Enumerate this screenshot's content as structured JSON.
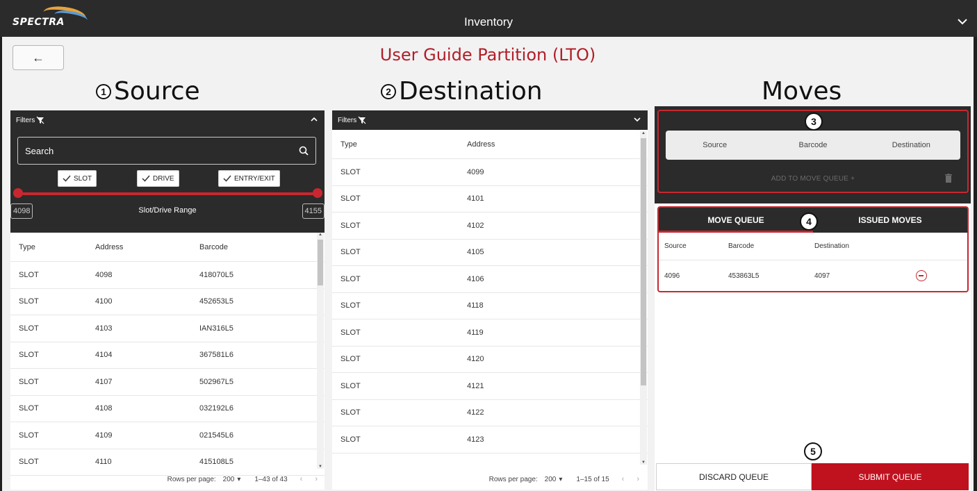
{
  "topbar": {
    "brand": "SPECTRA",
    "title": "Inventory"
  },
  "page": {
    "partition_title": "User Guide Partition (LTO)"
  },
  "columns": {
    "source_title": "Source",
    "source_num": "1",
    "destination_title": "Destination",
    "destination_num": "2",
    "moves_title": "Moves"
  },
  "source": {
    "filters_label": "Filters",
    "search_placeholder": "Search",
    "checks": {
      "slot": "SLOT",
      "drive": "DRIVE",
      "entry": "ENTRY/EXIT"
    },
    "range": {
      "min": "4098",
      "max": "4155",
      "label": "Slot/Drive Range"
    },
    "headers": {
      "type": "Type",
      "address": "Address",
      "barcode": "Barcode"
    },
    "rows": [
      {
        "type": "SLOT",
        "address": "4098",
        "barcode": "418070L5"
      },
      {
        "type": "SLOT",
        "address": "4100",
        "barcode": "452653L5"
      },
      {
        "type": "SLOT",
        "address": "4103",
        "barcode": "IAN316L5"
      },
      {
        "type": "SLOT",
        "address": "4104",
        "barcode": "367581L6"
      },
      {
        "type": "SLOT",
        "address": "4107",
        "barcode": "502967L5"
      },
      {
        "type": "SLOT",
        "address": "4108",
        "barcode": "032192L6"
      },
      {
        "type": "SLOT",
        "address": "4109",
        "barcode": "021545L6"
      },
      {
        "type": "SLOT",
        "address": "4110",
        "barcode": "415108L5"
      }
    ],
    "pager": {
      "rows_label": "Rows per page:",
      "rows_value": "200",
      "range": "1–43 of 43"
    }
  },
  "destination": {
    "filters_label": "Filters",
    "headers": {
      "type": "Type",
      "address": "Address"
    },
    "rows": [
      {
        "type": "SLOT",
        "address": "4099"
      },
      {
        "type": "SLOT",
        "address": "4101"
      },
      {
        "type": "SLOT",
        "address": "4102"
      },
      {
        "type": "SLOT",
        "address": "4105"
      },
      {
        "type": "SLOT",
        "address": "4106"
      },
      {
        "type": "SLOT",
        "address": "4118"
      },
      {
        "type": "SLOT",
        "address": "4119"
      },
      {
        "type": "SLOT",
        "address": "4120"
      },
      {
        "type": "SLOT",
        "address": "4121"
      },
      {
        "type": "SLOT",
        "address": "4122"
      },
      {
        "type": "SLOT",
        "address": "4123"
      }
    ],
    "pager": {
      "rows_label": "Rows per page:",
      "rows_value": "200",
      "range": "1–15 of 15"
    }
  },
  "moves": {
    "headers": {
      "source": "Source",
      "barcode": "Barcode",
      "destination": "Destination"
    },
    "add_label": "ADD TO MOVE QUEUE +",
    "badge3": "3",
    "badge4": "4",
    "badge5": "5",
    "tabs": {
      "queue": "MOVE QUEUE",
      "issued": "ISSUED MOVES"
    },
    "queue_headers": {
      "source": "Source",
      "barcode": "Barcode",
      "destination": "Destination"
    },
    "queue_rows": [
      {
        "source": "4096",
        "barcode": "453863L5",
        "destination": "4097"
      }
    ],
    "discard_label": "DISCARD QUEUE",
    "submit_label": "SUBMIT QUEUE"
  },
  "colors": {
    "accent": "#c8272f",
    "dark": "#2b2b2b",
    "submit": "#c0111f"
  }
}
